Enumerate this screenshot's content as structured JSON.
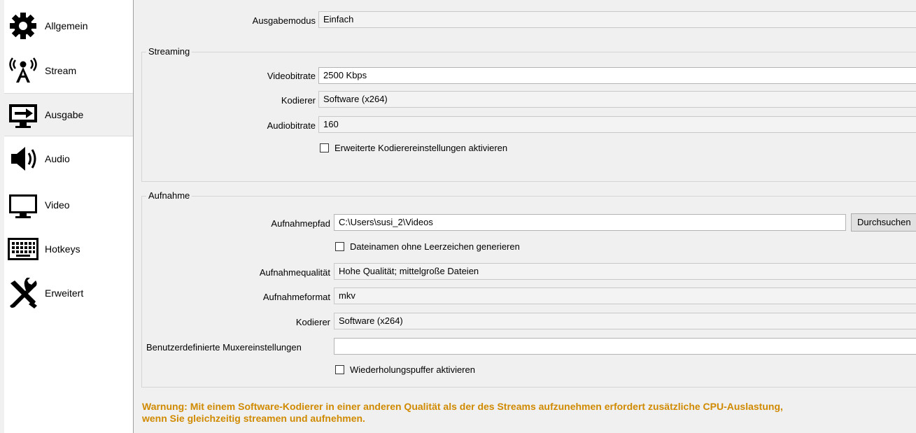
{
  "sidebar": {
    "items": [
      {
        "label": "Allgemein",
        "icon": "gear-icon"
      },
      {
        "label": "Stream",
        "icon": "antenna-icon"
      },
      {
        "label": "Ausgabe",
        "icon": "monitor-output-icon"
      },
      {
        "label": "Audio",
        "icon": "speaker-icon"
      },
      {
        "label": "Video",
        "icon": "monitor-icon"
      },
      {
        "label": "Hotkeys",
        "icon": "keyboard-icon"
      },
      {
        "label": "Erweitert",
        "icon": "tools-icon"
      }
    ],
    "selected": "Ausgabe"
  },
  "output_mode": {
    "label": "Ausgabemodus",
    "value": "Einfach"
  },
  "streaming": {
    "title": "Streaming",
    "video_bitrate": {
      "label": "Videobitrate",
      "value": "2500 Kbps"
    },
    "encoder": {
      "label": "Kodierer",
      "value": "Software (x264)"
    },
    "audio_bitrate": {
      "label": "Audiobitrate",
      "value": "160"
    },
    "advanced_checkbox": {
      "label": "Erweiterte Kodierereinstellungen aktivieren",
      "checked": false
    }
  },
  "recording": {
    "title": "Aufnahme",
    "path": {
      "label": "Aufnahmepfad",
      "value": "C:\\Users\\susi_2\\Videos",
      "browse_label": "Durchsuchen"
    },
    "no_spaces_checkbox": {
      "label": "Dateinamen ohne Leerzeichen generieren",
      "checked": false
    },
    "quality": {
      "label": "Aufnahmequalität",
      "value": "Hohe Qualität; mittelgroße Dateien"
    },
    "format": {
      "label": "Aufnahmeformat",
      "value": "mkv"
    },
    "encoder": {
      "label": "Kodierer",
      "value": "Software (x264)"
    },
    "muxer": {
      "label": "Benutzerdefinierte Muxereinstellungen",
      "value": ""
    },
    "replay_checkbox": {
      "label": "Wiederholungspuffer aktivieren",
      "checked": false
    }
  },
  "warning": {
    "line1": "Warnung: Mit einem Software-Kodierer in einer anderen Qualität als der des Streams aufzunehmen erfordert zusätzliche CPU-Auslastung,",
    "line2": "wenn Sie gleichzeitig streamen und aufnehmen.",
    "color": "#d08a00"
  }
}
